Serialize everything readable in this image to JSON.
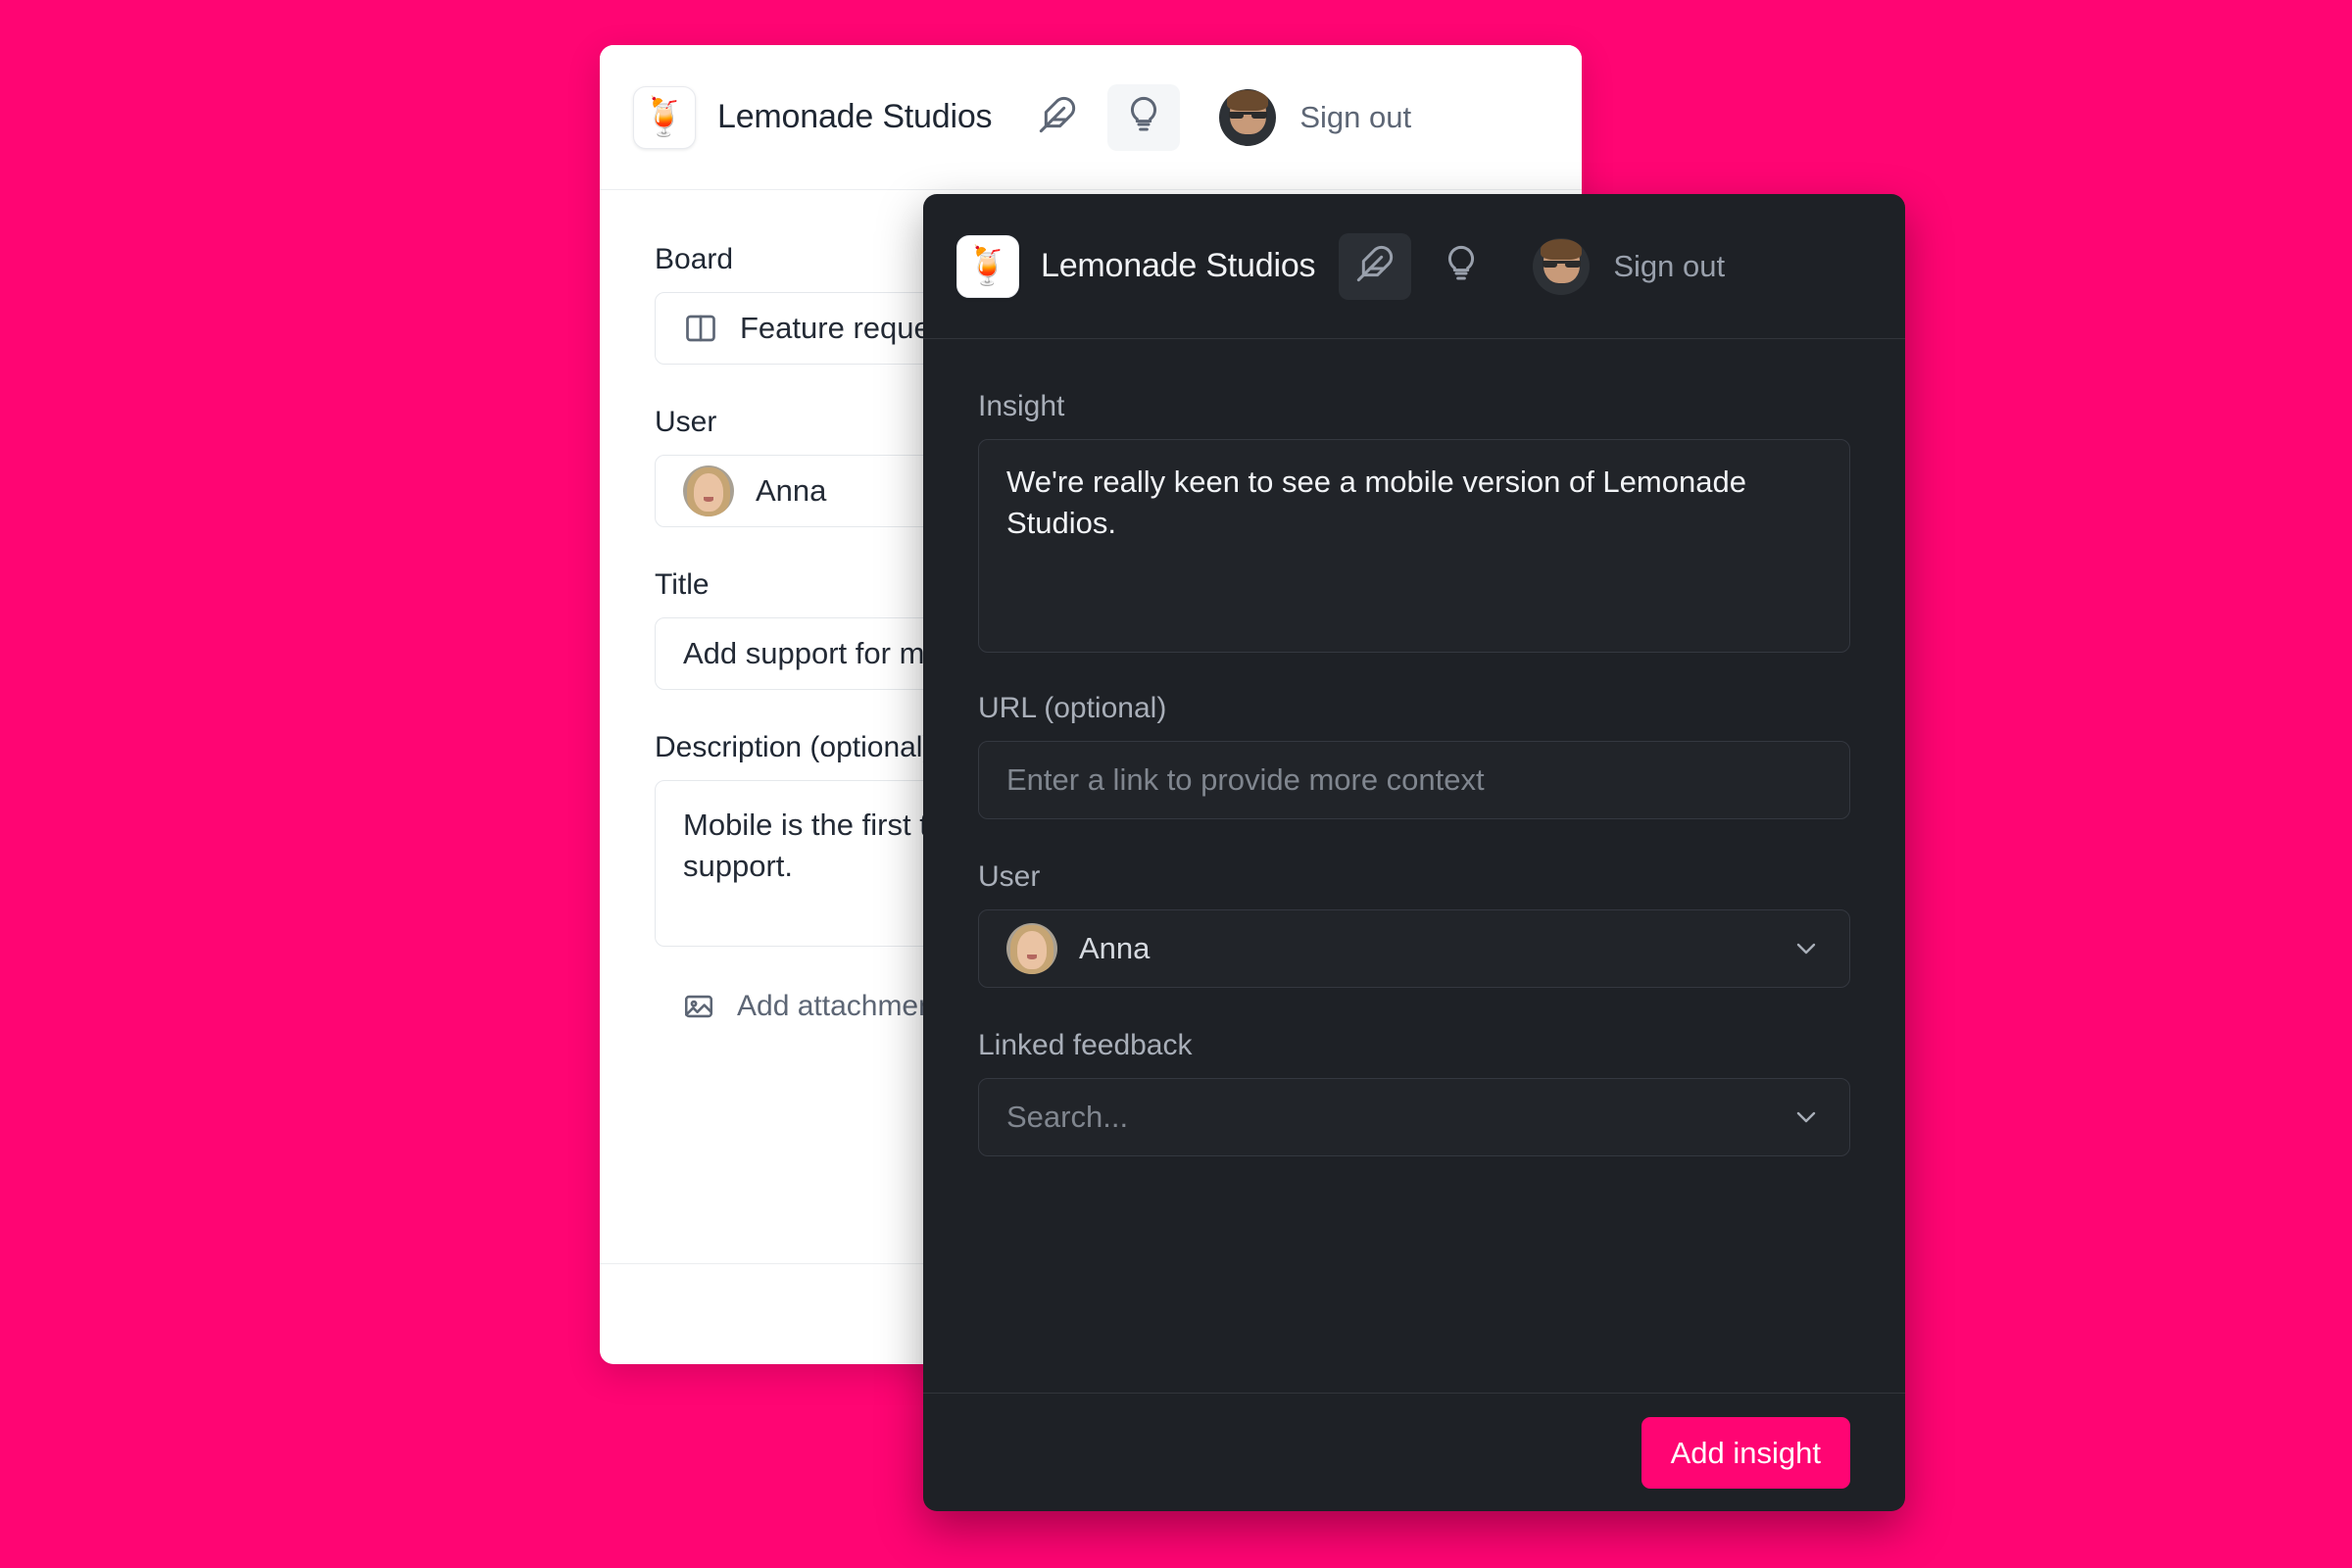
{
  "theme": {
    "background_color": "#ff0573",
    "accent_color": "#ff0573",
    "light_panel_bg": "#ffffff",
    "dark_panel_bg": "#1e2126"
  },
  "light_widget": {
    "header": {
      "logo_icon": "lemonade-pitcher-emoji",
      "logo_glyph": "🍹",
      "brand_name": "Lemonade Studios",
      "feather_icon": "feather-icon",
      "bulb_icon": "lightbulb-icon",
      "active_tab": "bulb",
      "avatar_icon": "user-avatar",
      "signout_label": "Sign out"
    },
    "form": {
      "board_label": "Board",
      "board_icon": "columns-icon",
      "board_value": "Feature requests",
      "user_label": "User",
      "user_value": "Anna",
      "title_label": "Title",
      "title_value": "Add support for mobile",
      "description_label": "Description (optional)",
      "description_value": "Mobile is the first thing we need Lemonade Studios to support.",
      "attachment_icon": "image-icon",
      "attachment_label": "Add attachment"
    }
  },
  "dark_widget": {
    "header": {
      "logo_icon": "lemonade-pitcher-emoji",
      "logo_glyph": "🍹",
      "brand_name": "Lemonade Studios",
      "feather_icon": "feather-icon",
      "bulb_icon": "lightbulb-icon",
      "active_tab": "feather",
      "avatar_icon": "user-avatar",
      "signout_label": "Sign out"
    },
    "form": {
      "insight_label": "Insight",
      "insight_value": "We're really keen to see a mobile version of Lemonade Studios.",
      "url_label": "URL (optional)",
      "url_value": "",
      "url_placeholder": "Enter a link to provide more context",
      "user_label": "User",
      "user_value": "Anna",
      "user_chevron_icon": "chevron-down-icon",
      "linked_feedback_label": "Linked feedback",
      "linked_feedback_placeholder": "Search...",
      "linked_feedback_chevron_icon": "chevron-down-icon"
    },
    "footer": {
      "submit_label": "Add insight"
    }
  }
}
